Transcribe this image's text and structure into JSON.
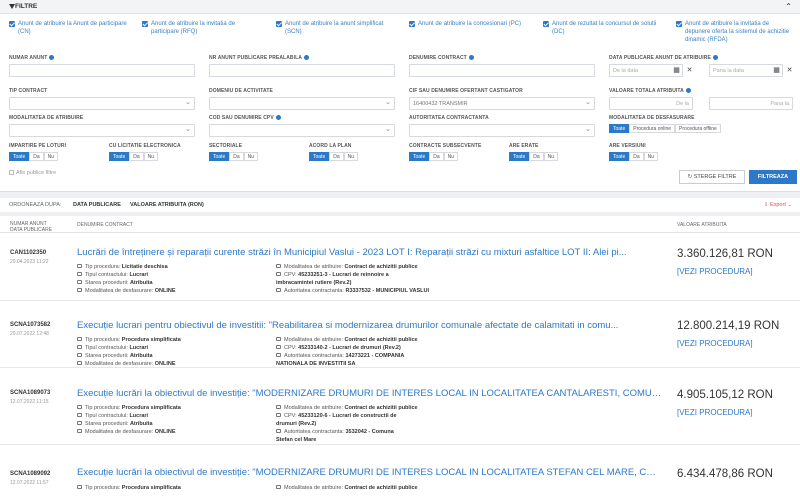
{
  "filter": {
    "title": "FILTRE",
    "checkboxes": [
      {
        "label": "Anunt de atribuire la Anunt de participare (CN)"
      },
      {
        "label": "Anunt de atribuire la invitatia de participare (RFQ)"
      },
      {
        "label": "Anunt de atribuire la anunt simplificat (SCN)"
      },
      {
        "label": "Anunt de atribuire la concesionari (PC)"
      },
      {
        "label": "Anunt de rezultat la concursul de solutii (DC)"
      },
      {
        "label": "Anunt de atribuire la invitatia de depunere oferta la sistemul de achizitie dinamic (RFDA)"
      }
    ],
    "fields": {
      "numar_anunt": "NUMAR ANUNT",
      "nr_anunt_prealabil": "NR ANUNT PUBLICARE PREALABILA",
      "denumire_contract": "DENUMIRE CONTRACT",
      "data_publicare": "DATA PUBLICARE ANUNT DE ATRIBUIRE",
      "de_la_data": "De la data",
      "pana_la_data": "Pana la data",
      "tip_contract": "TIP CONTRACT",
      "domeniu_activitate": "DOMENIU DE ACTIVITATE",
      "cif_ofertant": "CIF SAU DENUMIRE OFERTANT CASTIGATOR",
      "cif_value": "16400432 TRANSMIR",
      "valoare_totala": "VALOARE TOTALA ATRIBUITA",
      "de_la": "De la",
      "pana_la": "Pana la",
      "modalitatea_atribuire": "MODALITATEA DE ATRIBUIRE",
      "cod_cpv": "COD SAU DENUMIRE CPV",
      "autoritatea": "AUTORITATEA CONTRACTANTA",
      "modalitatea_desfasurare": "MODALITATEA DE DESFASURARE",
      "impartire_loturi": "IMPARTIRE PE LOTURI",
      "licitatie_electronica": "CU LICITATIE ELECTRONICA",
      "sectoriale": "SECTORIALE",
      "acord_plan": "ACORD LA PLAN",
      "contracte_subsecvente": "CONTRACTE SUBSECVENTE",
      "are_erate": "ARE ERATE",
      "are_versiuni": "ARE VERSIUNI"
    },
    "seg": {
      "toate": "Toate",
      "da": "Da",
      "nu": "Nu"
    },
    "desfasurare_options": [
      "Toate",
      "Procedura online",
      "Procedura offline"
    ],
    "show_public": "Afis publice filtre",
    "clear_label": "STERGE FILTRE",
    "filter_label": "FILTREAZA"
  },
  "sort": {
    "label": "ORDONEAZA DUPA:",
    "date": "DATA PUBLICARE",
    "value": "VALOARE ATRIBUITA (RON)",
    "export": "Export"
  },
  "table": {
    "col_nr": "NUMAR ANUNT",
    "col_date": "DATA PUBLICARE",
    "col_contract": "DENUMIRE CONTRACT",
    "col_value": "VALOARE ATRIBUITA",
    "view_label": "[VEZI PROCEDURA]",
    "rows": [
      {
        "code": "CAN1102350",
        "date": "20.04.2023 11:22",
        "title": "Lucrări de întreținere și reparații curente străzi în Municipiul Vaslui - 2023 LOT I: Reparații străzi cu mixturi asfaltice LOT II: Alei pi...",
        "tip_procedura_l": "Tip procedura:",
        "tip_procedura": "Licitatie deschisa",
        "tip_contract_l": "Tipul contractului:",
        "tip_contract": "Lucrari",
        "stare_l": "Starea procedurii:",
        "stare": "Atribuita",
        "mod_desf_l": "Modalitatea de desfasurare:",
        "mod_desf": "ONLINE",
        "mod_atr_l": "Modalitatea de atribuire:",
        "mod_atr": "Contract de achizitii publice",
        "cpv_l": "CPV:",
        "cpv": "45233251-3 - Lucrari de reinnoire a imbracamintei rutiere (Rev.2)",
        "cpv_line2": "rutiere (Rev.2)",
        "aut_l": "Autoritatea contractanta:",
        "aut": "R3337532 - MUNICIPIUL VASLUI",
        "aut_line2": "",
        "amount": "3.360.126,81",
        "currency": "RON"
      },
      {
        "code": "SCNA1073582",
        "date": "20.07.2022 12:48",
        "title": "Execuție lucrari pentru obiectivul de investitii: \"Reabilitarea si modernizarea drumurilor comunale afectate de calamitati in comu...",
        "tip_procedura_l": "Tip procedura:",
        "tip_procedura": "Procedura simplificata",
        "tip_contract_l": "Tipul contractului:",
        "tip_contract": "Lucrari",
        "stare_l": "Starea procedurii:",
        "stare": "Atribuita",
        "mod_desf_l": "Modalitatea de desfasurare:",
        "mod_desf": "ONLINE",
        "mod_atr_l": "Modalitatea de atribuire:",
        "mod_atr": "Contract de achizitii publice",
        "cpv_l": "CPV:",
        "cpv": "45233140-2 - Lucrari de drumuri (Rev.2)",
        "cpv_line2": "",
        "aut_l": "Autoritatea contractanta:",
        "aut": "14273221 - COMPANIA",
        "aut_line2": "NATIONALA DE INVESTITII SA",
        "amount": "12.800.214,19",
        "currency": "RON"
      },
      {
        "code": "SCNA1089073",
        "date": "12.07.2022 11:15",
        "title": "Execuție lucrări la obiectivul de investiție: \"MODERNIZARE DRUMURI DE INTERES LOCAL IN LOCALITATEA CANTALARESTI, COMUN...",
        "tip_procedura_l": "Tip procedura:",
        "tip_procedura": "Procedura simplificata",
        "tip_contract_l": "Tipul contractului:",
        "tip_contract": "Lucrari",
        "stare_l": "Starea procedurii:",
        "stare": "Atribuita",
        "mod_desf_l": "Modalitatea de desfasurare:",
        "mod_desf": "ONLINE",
        "mod_atr_l": "Modalitatea de atribuire:",
        "mod_atr": "Contract de achizitii publice",
        "cpv_l": "CPV:",
        "cpv": "45233120-6 - Lucrari de constructii de drumuri",
        "cpv_line2": "(Rev.2)",
        "aut_l": "Autoritatea contractanta:",
        "aut": "3532042 - Comuna Stefan cel",
        "aut_line2": "Mare",
        "amount": "4.905.105,12",
        "currency": "RON"
      },
      {
        "code": "SCNA1089092",
        "date": "12.07.2022 11:57",
        "title": "Execuție lucrări la obiectivul de investiție: \"MODERNIZARE DRUMURI DE INTERES LOCAL IN LOCALITATEA STEFAN CEL MARE, COM...",
        "tip_procedura_l": "Tip procedura:",
        "tip_procedura": "Procedura simplificata",
        "tip_contract_l": "",
        "tip_contract": "",
        "stare_l": "",
        "stare": "",
        "mod_desf_l": "",
        "mod_desf": "",
        "mod_atr_l": "Modalitatea de atribuire:",
        "mod_atr": "Contract de achizitii publice",
        "cpv_l": "",
        "cpv": "",
        "cpv_line2": "",
        "aut_l": "",
        "aut": "",
        "aut_line2": "",
        "amount": "6.434.478,86",
        "currency": "RON"
      }
    ]
  },
  "colors": {
    "accent": "#2c78c9",
    "export": "#d9534f"
  }
}
